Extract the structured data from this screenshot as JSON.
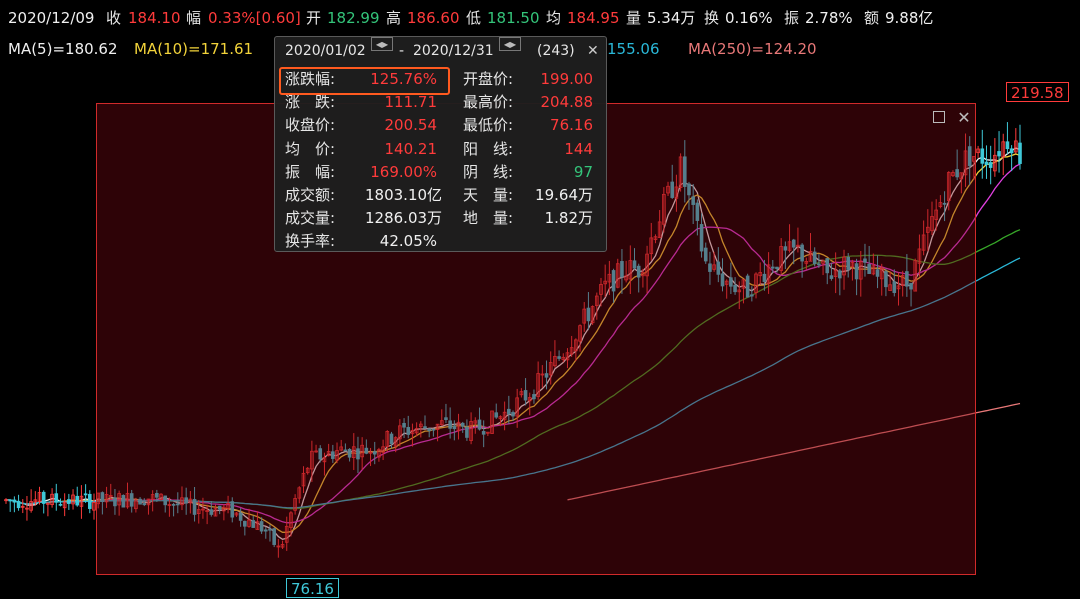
{
  "topbar": {
    "date": "2020/12/09",
    "close_label": "收",
    "close_value": "184.10",
    "chg_label": "幅",
    "chg_value": "0.33%[0.60]",
    "open_label": "开",
    "open_value": "182.99",
    "high_label": "高",
    "high_value": "186.60",
    "low_label": "低",
    "low_value": "181.50",
    "avg_label": "均",
    "avg_value": "184.95",
    "vol_label": "量",
    "vol_value": "5.34万",
    "turnover_label": "换",
    "turnover_value": "0.16%",
    "amp_label": "振",
    "amp_value": "2.78%",
    "amount_label": "额",
    "amount_value": "9.88亿"
  },
  "ma_bar": {
    "ma5": "MA(5)=180.62",
    "ma10": "MA(10)=171.61",
    "ma60_tail": "155.06",
    "ma250": "MA(250)=124.20"
  },
  "stats_panel": {
    "start_date": "2020/01/02",
    "sep": "-",
    "end_date": "2020/12/31",
    "count": "(243)",
    "close_icon": "close-icon",
    "rows": [
      {
        "k1": "涨跌幅:",
        "v1": "125.76%",
        "k2": "开盘价:",
        "v2": "199.00"
      },
      {
        "k1": "涨　跌:",
        "v1": "111.71",
        "k2": "最高价:",
        "v2": "204.88"
      },
      {
        "k1": "收盘价:",
        "v1": "200.54",
        "k2": "最低价:",
        "v2": "76.16"
      },
      {
        "k1": "均　价:",
        "v1": "140.21",
        "k2": "阳　线:",
        "v2": "144"
      },
      {
        "k1": "振　幅:",
        "v1": "169.00%",
        "k2": "阴　线:",
        "v2": "97"
      },
      {
        "k1": "成交额:",
        "v1": "1803.10亿",
        "k2": "天　量:",
        "v2": "19.64万"
      },
      {
        "k1": "成交量:",
        "v1": "1286.03万",
        "k2": "地　量:",
        "v2": "1.82万"
      },
      {
        "k1": "换手率:",
        "v1": "42.05%"
      }
    ]
  },
  "markers": {
    "high_label": "219.58",
    "low_label": "76.16"
  },
  "colors": {
    "up": "#ff3b3b",
    "down": "#3fc8d8",
    "ma5": "#f0f0f0",
    "ma10": "#f2d33a",
    "ma20": "#e040e0",
    "ma60": "#37a829",
    "ma120": "#2ab8d8",
    "ma250": "#e87878"
  },
  "chart_data": {
    "type": "candlestick",
    "title": "",
    "xlabel": "",
    "ylabel": "",
    "ylim": [
      70,
      225
    ],
    "grid": false,
    "series": [
      {
        "name": "MA(5)",
        "values": [
          180.62
        ]
      },
      {
        "name": "MA(10)",
        "values": [
          171.61
        ]
      },
      {
        "name": "MA(60)",
        "values": [
          155.06
        ]
      },
      {
        "name": "MA(250)",
        "values": [
          124.2
        ]
      }
    ],
    "annotations": [
      {
        "text": "219.58",
        "kind": "period high"
      },
      {
        "text": "76.16",
        "kind": "period low"
      }
    ],
    "price_path": [
      [
        0,
        95
      ],
      [
        0.05,
        95
      ],
      [
        0.1,
        95
      ],
      [
        0.14,
        96
      ],
      [
        0.18,
        93
      ],
      [
        0.22,
        92
      ],
      [
        0.255,
        86
      ],
      [
        0.27,
        79
      ],
      [
        0.285,
        95
      ],
      [
        0.3,
        108
      ],
      [
        0.33,
        111
      ],
      [
        0.36,
        111
      ],
      [
        0.39,
        117
      ],
      [
        0.43,
        119
      ],
      [
        0.46,
        117
      ],
      [
        0.49,
        122
      ],
      [
        0.52,
        130
      ],
      [
        0.55,
        142
      ],
      [
        0.57,
        152
      ],
      [
        0.59,
        162
      ],
      [
        0.61,
        168
      ],
      [
        0.625,
        168
      ],
      [
        0.645,
        185
      ],
      [
        0.665,
        200
      ],
      [
        0.69,
        170
      ],
      [
        0.71,
        164
      ],
      [
        0.73,
        161
      ],
      [
        0.755,
        170
      ],
      [
        0.78,
        174
      ],
      [
        0.81,
        166
      ],
      [
        0.83,
        170
      ],
      [
        0.86,
        165
      ],
      [
        0.89,
        163
      ],
      [
        0.91,
        180
      ],
      [
        0.93,
        196
      ],
      [
        0.95,
        204
      ],
      [
        0.97,
        203
      ],
      [
        0.99,
        210
      ],
      [
        1.0,
        204
      ]
    ]
  }
}
